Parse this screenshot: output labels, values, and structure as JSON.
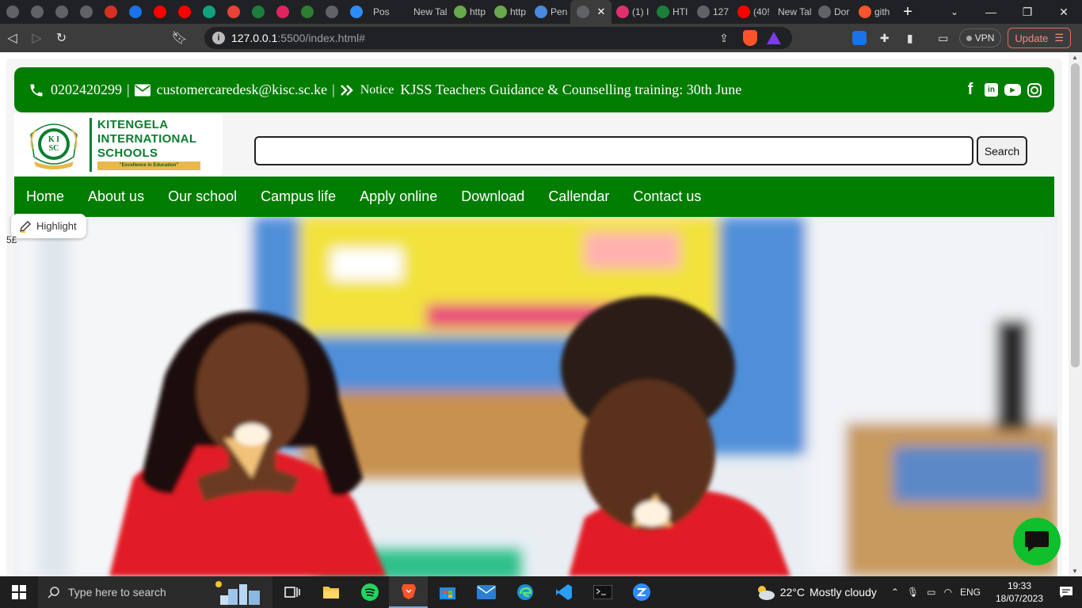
{
  "browser": {
    "tabs": [
      {
        "label": "",
        "icon": "globe-icon",
        "color": "#5f6368"
      },
      {
        "label": "",
        "icon": "globe-icon",
        "color": "#5f6368"
      },
      {
        "label": "",
        "icon": "globe-icon",
        "color": "#5f6368"
      },
      {
        "label": "",
        "icon": "globe-icon",
        "color": "#5f6368"
      },
      {
        "label": "",
        "icon": "download-icon",
        "color": "#d93025"
      },
      {
        "label": "",
        "icon": "contacts-icon",
        "color": "#1a73e8"
      },
      {
        "label": "",
        "icon": "youtube-icon",
        "color": "#ff0000"
      },
      {
        "label": "",
        "icon": "youtube-icon",
        "color": "#ff0000"
      },
      {
        "label": "",
        "icon": "chatgpt-icon",
        "color": "#10a37f"
      },
      {
        "label": "",
        "icon": "gmail-icon",
        "color": "#ea4335"
      },
      {
        "label": "",
        "icon": "w-icon",
        "color": "#1b7f3b"
      },
      {
        "label": "",
        "icon": "arrow-icon",
        "color": "#e0245e"
      },
      {
        "label": "",
        "icon": "leaf-icon",
        "color": "#2e7d32"
      },
      {
        "label": "",
        "icon": "globe-icon",
        "color": "#5f6368"
      },
      {
        "label": "",
        "icon": "zoom-icon",
        "color": "#2d8cff"
      },
      {
        "label": "Pos",
        "icon": "",
        "color": ""
      },
      {
        "label": "New Tal",
        "icon": "",
        "color": ""
      },
      {
        "label": "http",
        "icon": "school-logo-icon",
        "color": "#6aa84f"
      },
      {
        "label": "http",
        "icon": "school-logo-icon",
        "color": "#6aa84f"
      },
      {
        "label": "Pen",
        "icon": "flag-icon",
        "color": "#4a89dc"
      },
      {
        "label": "",
        "icon": "globe-icon",
        "color": "#5f6368",
        "active": true
      },
      {
        "label": "(1) I",
        "icon": "instagram-icon",
        "color": "#e1306c"
      },
      {
        "label": "HTI",
        "icon": "w-icon",
        "color": "#1b7f3b"
      },
      {
        "label": "127",
        "icon": "globe-icon",
        "color": "#5f6368"
      },
      {
        "label": "(40!",
        "icon": "youtube-icon",
        "color": "#ff0000"
      },
      {
        "label": "New Tal",
        "icon": "",
        "color": ""
      },
      {
        "label": "Dor",
        "icon": "globe-icon",
        "color": "#5f6368"
      },
      {
        "label": "gith",
        "icon": "brave-shield-icon",
        "color": "#fb542b"
      }
    ],
    "url_host": "127.0.0.1",
    "url_rest": ":5500/index.html#",
    "vpn_label": "VPN",
    "update_label": "Update"
  },
  "site": {
    "phone": "0202420299",
    "email": "customercaredesk@kisc.sc.ke",
    "separator": "|",
    "notice_label": "Notice",
    "notice_text": "KJSS Teachers Guidance & Counselling training: 30th June",
    "logo": {
      "line1": "KITENGELA",
      "line2": "INTERNATIONAL",
      "line3": "SCHOOLS",
      "motto": "\"Excellence in Education\"",
      "crest_letters": "KISC"
    },
    "search_placeholder": "",
    "search_button": "Search",
    "nav": [
      "Home",
      "About us",
      "Our school",
      "Campus life",
      "Apply online",
      "Download",
      "Callendar",
      "Contact us"
    ],
    "highlight_label": "Highlight",
    "stray_text": "5£"
  },
  "taskbar": {
    "search_placeholder": "Type here to search",
    "weather_temp": "22°C",
    "weather_text": "Mostly cloudy",
    "lang": "ENG",
    "time": "19:33",
    "date": "18/07/2023"
  },
  "colors": {
    "site_green": "#017d01",
    "chat_green": "#0fbf2c",
    "logo_green": "#0b7d2f",
    "motto_gold": "#e8b84a"
  }
}
